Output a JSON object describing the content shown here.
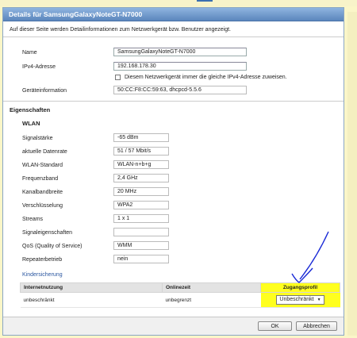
{
  "title": "Details für SamsungGalaxyNoteGT-N7000",
  "intro": "Auf dieser Seite werden Detailinformationen zum Netzwerkgerät bzw. Benutzer angezeigt.",
  "device": {
    "name_label": "Name",
    "name_value": "SamsungGalaxyNoteGT-N7000",
    "ipv4_label": "IPv4-Adresse",
    "ipv4_value": "192.168.178.30",
    "same_ip_label": "Diesem Netzwerkgerät immer die gleiche IPv4-Adresse zuweisen.",
    "same_ip_checked": false,
    "info_label": "Geräteinformation",
    "info_value": "50:CC:F8:CC:59:63, dhcpcd-5.5.6"
  },
  "properties": {
    "heading": "Eigenschaften",
    "wlan_heading": "WLAN",
    "rows": [
      {
        "label": "Signalstärke",
        "value": "-65 dBm"
      },
      {
        "label": "aktuelle Datenrate",
        "value": "51 / 57 Mbit/s"
      },
      {
        "label": "WLAN-Standard",
        "value": "WLAN-n+b+g"
      },
      {
        "label": "Frequenzband",
        "value": "2,4 GHz"
      },
      {
        "label": "Kanalbandbreite",
        "value": "20 MHz"
      },
      {
        "label": "Verschlüsselung",
        "value": "WPA2"
      },
      {
        "label": "Streams",
        "value": "1 x 1"
      },
      {
        "label": "Signaleigenschaften",
        "value": ""
      },
      {
        "label": "QoS (Quality of Service)",
        "value": "WMM"
      },
      {
        "label": "Repeaterbetrieb",
        "value": "nein"
      }
    ]
  },
  "kids": {
    "heading": "Kindersicherung",
    "col_usage": "Internetnutzung",
    "col_online": "Onlinezeit",
    "col_profile": "Zugangsprofil",
    "row_usage": "unbeschränkt",
    "row_online": "unbegrenzt",
    "row_profile": "Unbeschränkt"
  },
  "buttons": {
    "ok": "OK",
    "cancel": "Abbrechen"
  },
  "colors": {
    "titlebar": "#5b86bd",
    "highlight": "#ffff1f",
    "annotation": "#1a2ad6",
    "link": "#2b57a0"
  }
}
